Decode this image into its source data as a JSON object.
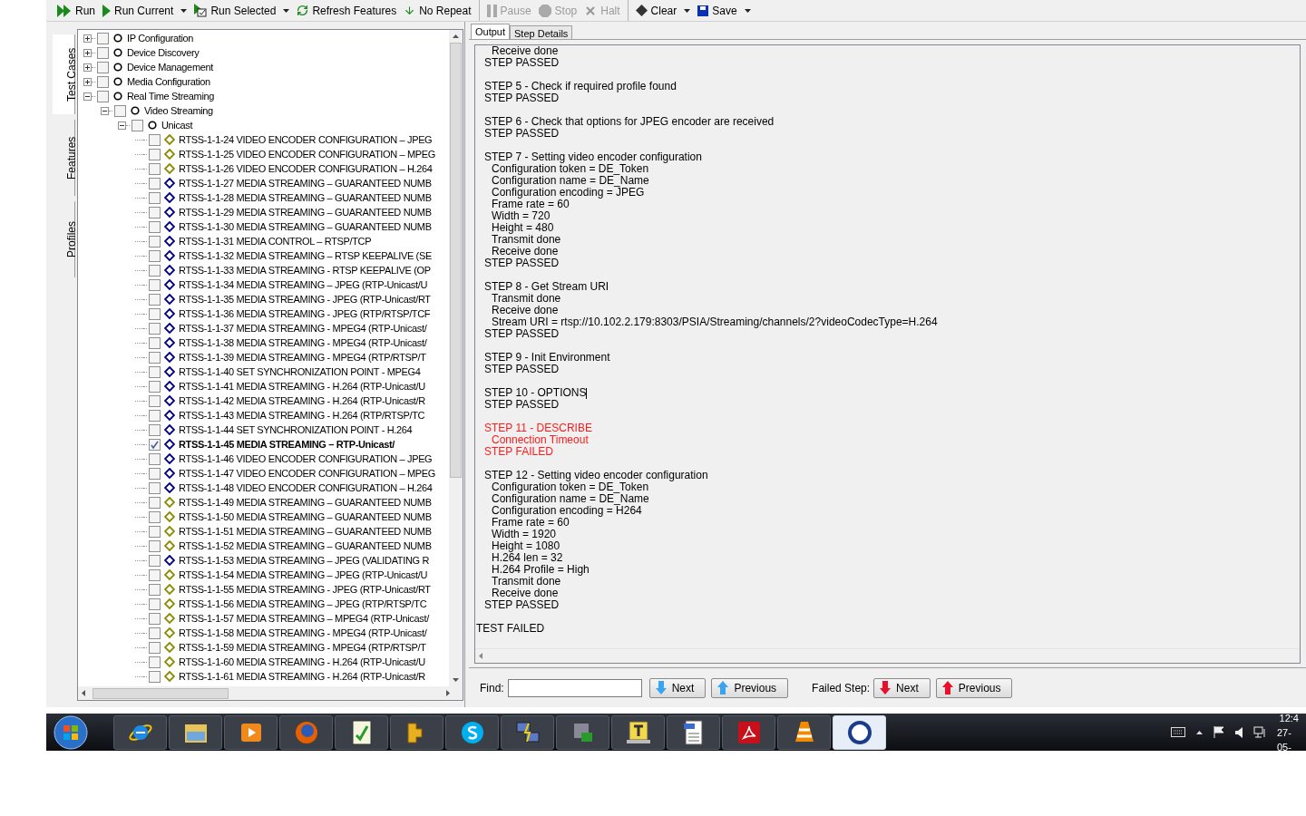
{
  "toolbar": {
    "groups": [
      [
        {
          "label": "Run",
          "kind": "run",
          "disabled": false,
          "dropdown": false
        },
        {
          "label": "Run Current",
          "kind": "run-current",
          "disabled": false,
          "dropdown": true
        },
        {
          "label": "Run Selected",
          "kind": "run-selected",
          "disabled": false,
          "dropdown": true
        },
        {
          "label": "Refresh Features",
          "kind": "refresh",
          "disabled": false,
          "dropdown": false
        },
        {
          "label": "No Repeat",
          "kind": "no-repeat",
          "disabled": false,
          "dropdown": false
        }
      ],
      [
        {
          "label": "Pause",
          "kind": "pause",
          "disabled": true,
          "dropdown": false
        },
        {
          "label": "Stop",
          "kind": "stop",
          "disabled": true,
          "dropdown": false
        },
        {
          "label": "Halt",
          "kind": "halt",
          "disabled": true,
          "dropdown": false
        }
      ],
      [
        {
          "label": "Clear",
          "kind": "clear",
          "disabled": false,
          "dropdown": true
        },
        {
          "label": "Save",
          "kind": "save",
          "disabled": false,
          "dropdown": true
        }
      ]
    ]
  },
  "side_tabs": [
    {
      "label": "Test Cases",
      "selected": true
    },
    {
      "label": "Features",
      "selected": false
    },
    {
      "label": "Profiles",
      "selected": false
    }
  ],
  "tree": [
    {
      "label": "IP Configuration",
      "kind": "group",
      "checked": false,
      "expanded": false,
      "selected": false
    },
    {
      "label": "Device Discovery",
      "kind": "group",
      "checked": false,
      "expanded": false,
      "selected": false
    },
    {
      "label": "Device Management",
      "kind": "group",
      "checked": false,
      "expanded": false,
      "selected": false
    },
    {
      "label": "Media Configuration",
      "kind": "group",
      "checked": false,
      "expanded": false,
      "selected": false
    },
    {
      "label": "Real Time Streaming",
      "kind": "group",
      "checked": false,
      "expanded": true,
      "selected": false,
      "children": [
        {
          "label": "Video Streaming",
          "kind": "group",
          "checked": false,
          "expanded": true,
          "selected": false,
          "children": [
            {
              "label": "Unicast",
              "kind": "group",
              "checked": false,
              "expanded": true,
              "selected": false,
              "children": [
                {
                  "label": "RTSS-1-1-24 VIDEO ENCODER CONFIGURATION – JPEG",
                  "kind": "test",
                  "color": "#8c8c00",
                  "checked": false,
                  "selected": false
                },
                {
                  "label": "RTSS-1-1-25 VIDEO ENCODER CONFIGURATION – MPEG",
                  "kind": "test",
                  "color": "#8c8c00",
                  "checked": false,
                  "selected": false
                },
                {
                  "label": "RTSS-1-1-26 VIDEO ENCODER CONFIGURATION – H.264",
                  "kind": "test",
                  "color": "#8c8c00",
                  "checked": false,
                  "selected": false
                },
                {
                  "label": "RTSS-1-1-27 MEDIA STREAMING – GUARANTEED NUMB",
                  "kind": "test",
                  "color": "#00008b",
                  "checked": false,
                  "selected": false
                },
                {
                  "label": "RTSS-1-1-28 MEDIA STREAMING – GUARANTEED NUMB",
                  "kind": "test",
                  "color": "#00008b",
                  "checked": false,
                  "selected": false
                },
                {
                  "label": "RTSS-1-1-29 MEDIA STREAMING – GUARANTEED NUMB",
                  "kind": "test",
                  "color": "#00008b",
                  "checked": false,
                  "selected": false
                },
                {
                  "label": "RTSS-1-1-30 MEDIA STREAMING – GUARANTEED NUMB",
                  "kind": "test",
                  "color": "#00008b",
                  "checked": false,
                  "selected": false
                },
                {
                  "label": "RTSS-1-1-31 MEDIA CONTROL – RTSP/TCP",
                  "kind": "test",
                  "color": "#00008b",
                  "checked": false,
                  "selected": false
                },
                {
                  "label": "RTSS-1-1-32 MEDIA STREAMING – RTSP KEEPALIVE (SE",
                  "kind": "test",
                  "color": "#00008b",
                  "checked": false,
                  "selected": false
                },
                {
                  "label": "RTSS-1-1-33 MEDIA STREAMING - RTSP KEEPALIVE (OP",
                  "kind": "test",
                  "color": "#00008b",
                  "checked": false,
                  "selected": false
                },
                {
                  "label": "RTSS-1-1-34 MEDIA STREAMING – JPEG (RTP-Unicast/U",
                  "kind": "test",
                  "color": "#00008b",
                  "checked": false,
                  "selected": false
                },
                {
                  "label": "RTSS-1-1-35 MEDIA STREAMING - JPEG (RTP-Unicast/RT",
                  "kind": "test",
                  "color": "#00008b",
                  "checked": false,
                  "selected": false
                },
                {
                  "label": "RTSS-1-1-36 MEDIA STREAMING - JPEG (RTP/RTSP/TCF",
                  "kind": "test",
                  "color": "#00008b",
                  "checked": false,
                  "selected": false
                },
                {
                  "label": "RTSS-1-1-37 MEDIA STREAMING - MPEG4 (RTP-Unicast/",
                  "kind": "test",
                  "color": "#00008b",
                  "checked": false,
                  "selected": false
                },
                {
                  "label": "RTSS-1-1-38 MEDIA STREAMING - MPEG4 (RTP-Unicast/",
                  "kind": "test",
                  "color": "#00008b",
                  "checked": false,
                  "selected": false
                },
                {
                  "label": "RTSS-1-1-39 MEDIA STREAMING - MPEG4 (RTP/RTSP/T",
                  "kind": "test",
                  "color": "#00008b",
                  "checked": false,
                  "selected": false
                },
                {
                  "label": "RTSS-1-1-40 SET SYNCHRONIZATION POINT - MPEG4",
                  "kind": "test",
                  "color": "#00008b",
                  "checked": false,
                  "selected": false
                },
                {
                  "label": "RTSS-1-1-41 MEDIA STREAMING - H.264 (RTP-Unicast/U",
                  "kind": "test",
                  "color": "#00008b",
                  "checked": false,
                  "selected": false
                },
                {
                  "label": "RTSS-1-1-42 MEDIA STREAMING - H.264 (RTP-Unicast/R",
                  "kind": "test",
                  "color": "#00008b",
                  "checked": false,
                  "selected": false
                },
                {
                  "label": "RTSS-1-1-43 MEDIA STREAMING - H.264 (RTP/RTSP/TC",
                  "kind": "test",
                  "color": "#00008b",
                  "checked": false,
                  "selected": false
                },
                {
                  "label": "RTSS-1-1-44 SET SYNCHRONIZATION POINT - H.264",
                  "kind": "test",
                  "color": "#00008b",
                  "checked": false,
                  "selected": false
                },
                {
                  "label": "RTSS-1-1-45 MEDIA STREAMING – RTP-Unicast/",
                  "kind": "test",
                  "color": "#00008b",
                  "checked": true,
                  "selected": true
                },
                {
                  "label": "RTSS-1-1-46 VIDEO ENCODER CONFIGURATION – JPEG",
                  "kind": "test",
                  "color": "#00008b",
                  "checked": false,
                  "selected": false
                },
                {
                  "label": "RTSS-1-1-47 VIDEO ENCODER CONFIGURATION – MPEG",
                  "kind": "test",
                  "color": "#00008b",
                  "checked": false,
                  "selected": false
                },
                {
                  "label": "RTSS-1-1-48 VIDEO ENCODER CONFIGURATION – H.264",
                  "kind": "test",
                  "color": "#00008b",
                  "checked": false,
                  "selected": false
                },
                {
                  "label": "RTSS-1-1-49 MEDIA STREAMING – GUARANTEED NUMB",
                  "kind": "test",
                  "color": "#8c8c00",
                  "checked": false,
                  "selected": false
                },
                {
                  "label": "RTSS-1-1-50 MEDIA STREAMING – GUARANTEED NUMB",
                  "kind": "test",
                  "color": "#8c8c00",
                  "checked": false,
                  "selected": false
                },
                {
                  "label": "RTSS-1-1-51 MEDIA STREAMING – GUARANTEED NUMB",
                  "kind": "test",
                  "color": "#8c8c00",
                  "checked": false,
                  "selected": false
                },
                {
                  "label": "RTSS-1-1-52 MEDIA STREAMING – GUARANTEED NUMB",
                  "kind": "test",
                  "color": "#8c8c00",
                  "checked": false,
                  "selected": false
                },
                {
                  "label": "RTSS-1-1-53 MEDIA STREAMING – JPEG (VALIDATING R",
                  "kind": "test",
                  "color": "#00008b",
                  "checked": false,
                  "selected": false
                },
                {
                  "label": "RTSS-1-1-54 MEDIA STREAMING – JPEG (RTP-Unicast/U",
                  "kind": "test",
                  "color": "#8c8c00",
                  "checked": false,
                  "selected": false
                },
                {
                  "label": "RTSS-1-1-55 MEDIA STREAMING - JPEG (RTP-Unicast/RT",
                  "kind": "test",
                  "color": "#8c8c00",
                  "checked": false,
                  "selected": false
                },
                {
                  "label": "RTSS-1-1-56 MEDIA STREAMING – JPEG (RTP/RTSP/TC",
                  "kind": "test",
                  "color": "#8c8c00",
                  "checked": false,
                  "selected": false
                },
                {
                  "label": "RTSS-1-1-57 MEDIA STREAMING – MPEG4 (RTP-Unicast/",
                  "kind": "test",
                  "color": "#8c8c00",
                  "checked": false,
                  "selected": false
                },
                {
                  "label": "RTSS-1-1-58 MEDIA STREAMING - MPEG4 (RTP-Unicast/",
                  "kind": "test",
                  "color": "#8c8c00",
                  "checked": false,
                  "selected": false
                },
                {
                  "label": "RTSS-1-1-59 MEDIA STREAMING - MPEG4 (RTP/RTSP/T",
                  "kind": "test",
                  "color": "#8c8c00",
                  "checked": false,
                  "selected": false
                },
                {
                  "label": "RTSS-1-1-60 MEDIA STREAMING - H.264 (RTP-Unicast/U",
                  "kind": "test",
                  "color": "#8c8c00",
                  "checked": false,
                  "selected": false
                },
                {
                  "label": "RTSS-1-1-61 MEDIA STREAMING - H.264 (RTP-Unicast/R",
                  "kind": "test",
                  "color": "#8c8c00",
                  "checked": false,
                  "selected": false
                }
              ]
            }
          ]
        }
      ]
    }
  ],
  "output_tabs": [
    {
      "label": "Output",
      "selected": true
    },
    {
      "label": "Step Details",
      "selected": false
    }
  ],
  "log": {
    "steps": [
      {
        "details": [
          "Receive done"
        ],
        "result": "STEP PASSED",
        "failed": false
      },
      {
        "title": "STEP 5 - Check if required profile found",
        "result": "STEP PASSED",
        "failed": false
      },
      {
        "title": "STEP 6 - Check that options for JPEG encoder are received",
        "result": "STEP PASSED",
        "failed": false
      },
      {
        "title": "STEP 7 - Setting video encoder configuration",
        "details": [
          "Configuration token = DE_Token",
          "Configuration name = DE_Name",
          "Configuration encoding = JPEG",
          "Frame rate = 60",
          "Width = 720",
          "Height = 480",
          "Transmit done",
          "Receive done"
        ],
        "result": "STEP PASSED",
        "failed": false
      },
      {
        "title": "STEP 8 - Get Stream URI",
        "details": [
          "Transmit done",
          "Receive done",
          "Stream URI = rtsp://10.102.2.179:8303/PSIA/Streaming/channels/2?videoCodecType=H.264"
        ],
        "result": "STEP PASSED",
        "failed": false
      },
      {
        "title": "STEP 9 - Init Environment",
        "result": "STEP PASSED",
        "failed": false
      },
      {
        "title": "STEP 10 - OPTIONS",
        "result": "STEP PASSED",
        "failed": false,
        "caret": true
      },
      {
        "title": "STEP 11 - DESCRIBE",
        "details": [
          "Connection Timeout"
        ],
        "result": "STEP FAILED",
        "failed": true
      },
      {
        "title": "STEP 12 - Setting video encoder configuration",
        "details": [
          "Configuration token = DE_Token",
          "Configuration name = DE_Name",
          "Configuration encoding = H264",
          "Frame rate = 60",
          "Width = 1920",
          "Height = 1080",
          "H.264 len = 32",
          "H.264 Profile = High",
          "Transmit done",
          "Receive done"
        ],
        "result": "STEP PASSED",
        "failed": false
      }
    ],
    "summary": "TEST FAILED"
  },
  "find_bar": {
    "label": "Find:",
    "buttons": [
      {
        "label": "Next",
        "kind": "down"
      },
      {
        "label": "Previous",
        "kind": "up"
      }
    ]
  },
  "failed_step_bar": {
    "label": "Failed Step:",
    "buttons": [
      {
        "label": "Next",
        "kind": "down"
      },
      {
        "label": "Previous",
        "kind": "up"
      }
    ]
  },
  "taskbar": {
    "apps": [
      {
        "kind": "browser",
        "selected": false
      },
      {
        "kind": "folder",
        "selected": false
      },
      {
        "kind": "media",
        "selected": false
      },
      {
        "kind": "fox",
        "selected": false
      },
      {
        "kind": "notepad",
        "selected": false
      },
      {
        "kind": "puzzle",
        "selected": false
      },
      {
        "kind": "chat",
        "selected": false
      },
      {
        "kind": "network",
        "selected": false
      },
      {
        "kind": "lock",
        "selected": false
      },
      {
        "kind": "letter",
        "selected": false
      },
      {
        "kind": "document",
        "selected": false
      },
      {
        "kind": "pdf",
        "selected": false
      },
      {
        "kind": "cone",
        "selected": false
      },
      {
        "kind": "ring",
        "selected": true
      }
    ],
    "time": "12:4",
    "date": "27-05-"
  }
}
